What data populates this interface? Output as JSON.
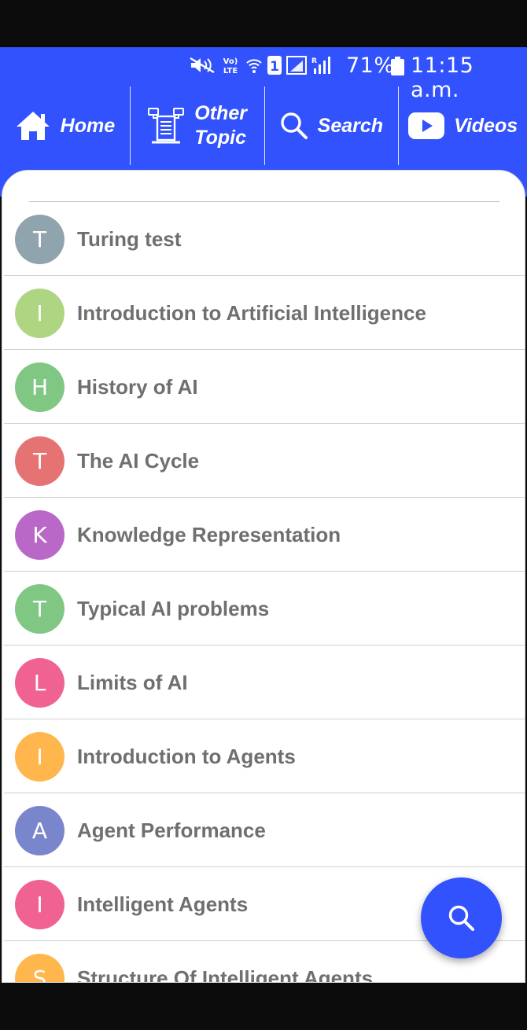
{
  "status_bar": {
    "icons": [
      "mute-icon",
      "volte-icon",
      "wifi-icon",
      "sim-1-icon",
      "signal-sim1-icon",
      "signal-sim2-icon",
      "battery-icon"
    ],
    "battery_percent": "71%",
    "time": "11:15 a.m."
  },
  "nav": {
    "home_label": "Home",
    "other_topic_line1": "Other",
    "other_topic_line2": "Topic",
    "search_label": "Search",
    "videos_label": "Videos"
  },
  "colors": {
    "brand": "#3252fd",
    "text": "#6f6f6f"
  },
  "topics": [
    {
      "initial": "T",
      "title": "Turing test",
      "color": "#90a4ae"
    },
    {
      "initial": "I",
      "title": "Introduction to Artificial Intelligence",
      "color": "#aed581"
    },
    {
      "initial": "H",
      "title": "History of AI",
      "color": "#81c784"
    },
    {
      "initial": "T",
      "title": "The AI Cycle",
      "color": "#e57373"
    },
    {
      "initial": "K",
      "title": "Knowledge Representation",
      "color": "#ba68c8"
    },
    {
      "initial": "T",
      "title": "Typical AI problems",
      "color": "#81c784"
    },
    {
      "initial": "L",
      "title": "Limits of AI",
      "color": "#f06292"
    },
    {
      "initial": "I",
      "title": "Introduction to Agents",
      "color": "#ffb74d"
    },
    {
      "initial": "A",
      "title": "Agent Performance",
      "color": "#7986cb"
    },
    {
      "initial": "I",
      "title": "Intelligent Agents",
      "color": "#f06292"
    },
    {
      "initial": "S",
      "title": "Structure Of Intelligent Agents",
      "color": "#ffb74d"
    }
  ],
  "fab": {
    "icon": "search-icon"
  }
}
